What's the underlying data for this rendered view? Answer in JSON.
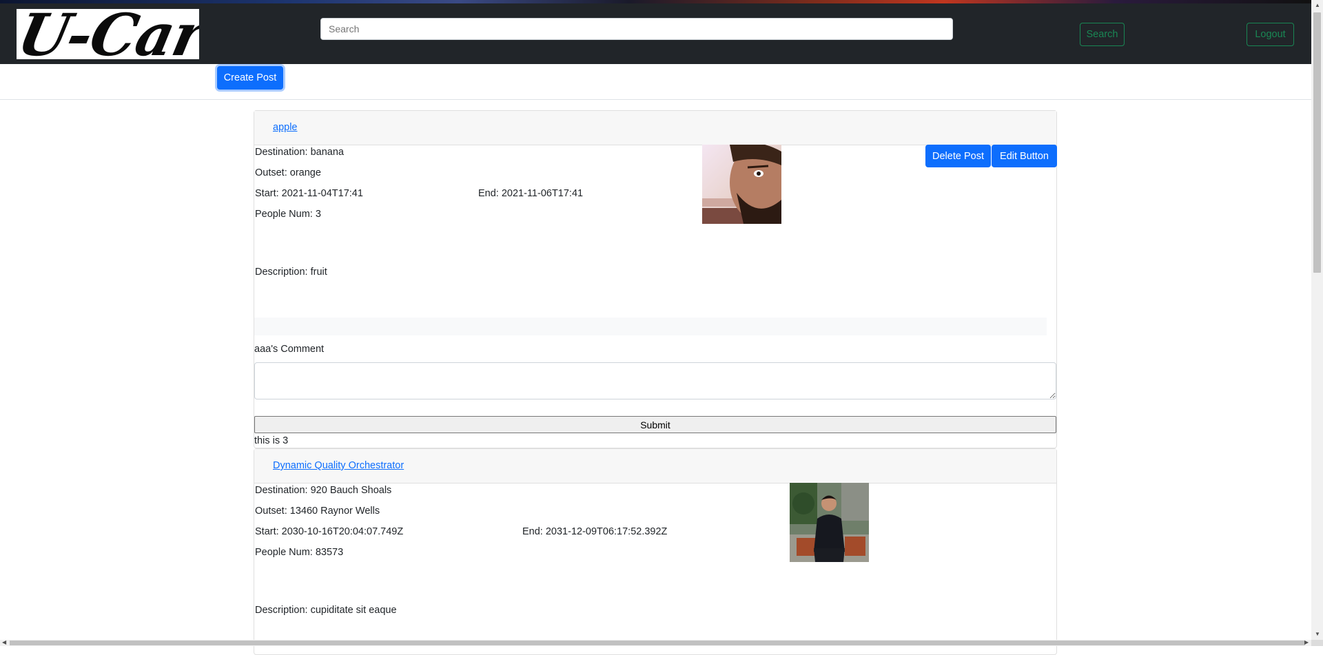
{
  "brand": {
    "logo_text": "U-Car"
  },
  "header": {
    "search_placeholder": "Search",
    "search_button": "Search",
    "logout_button": "Logout"
  },
  "toolbar": {
    "create_post": "Create Post"
  },
  "posts": [
    {
      "title": "apple",
      "destination": "Destination: banana",
      "outset": "Outset: orange",
      "start": "Start: 2021-11-04T17:41",
      "end": "End: 2021-11-06T17:41",
      "people": "People Num: 3",
      "description": "Description: fruit",
      "delete_button": "Delete Post",
      "edit_button": "Edit Button",
      "comment_label": "aaa's Comment",
      "submit_button": "Submit",
      "footer_text": "this is 3"
    },
    {
      "title": "Dynamic Quality Orchestrator",
      "destination": "Destination: 920 Bauch Shoals",
      "outset": "Outset: 13460 Raynor Wells",
      "start": "Start: 2030-10-16T20:04:07.749Z",
      "end": "End: 2031-12-09T06:17:52.392Z",
      "people": "People Num: 83573",
      "description": "Description: cupiditate sit eaque"
    }
  ],
  "colors": {
    "navbar": "#212529",
    "primary": "#0d6efd",
    "success_outline": "#198754"
  }
}
